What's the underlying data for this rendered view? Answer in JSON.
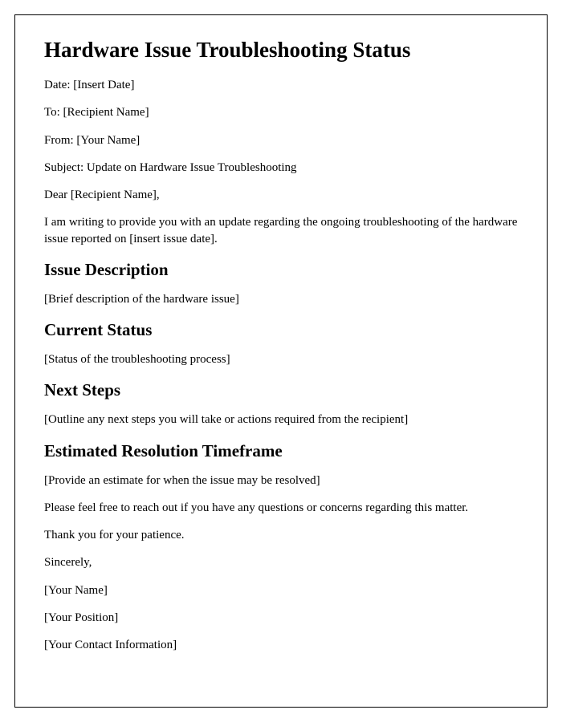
{
  "title": "Hardware Issue Troubleshooting Status",
  "header": {
    "date_line": "Date: [Insert Date]",
    "to_line": "To: [Recipient Name]",
    "from_line": "From: [Your Name]",
    "subject_line": "Subject: Update on Hardware Issue Troubleshooting"
  },
  "salutation": "Dear [Recipient Name],",
  "intro": "I am writing to provide you with an update regarding the ongoing troubleshooting of the hardware issue reported on [insert issue date].",
  "sections": {
    "issue_description": {
      "heading": "Issue Description",
      "body": "[Brief description of the hardware issue]"
    },
    "current_status": {
      "heading": "Current Status",
      "body": "[Status of the troubleshooting process]"
    },
    "next_steps": {
      "heading": "Next Steps",
      "body": "[Outline any next steps you will take or actions required from the recipient]"
    },
    "estimated_resolution": {
      "heading": "Estimated Resolution Timeframe",
      "body": "[Provide an estimate for when the issue may be resolved]"
    }
  },
  "closing": {
    "reachout": "Please feel free to reach out if you have any questions or concerns regarding this matter.",
    "thanks": "Thank you for your patience.",
    "signoff": "Sincerely,",
    "name": "[Your Name]",
    "position": "[Your Position]",
    "contact": "[Your Contact Information]"
  }
}
